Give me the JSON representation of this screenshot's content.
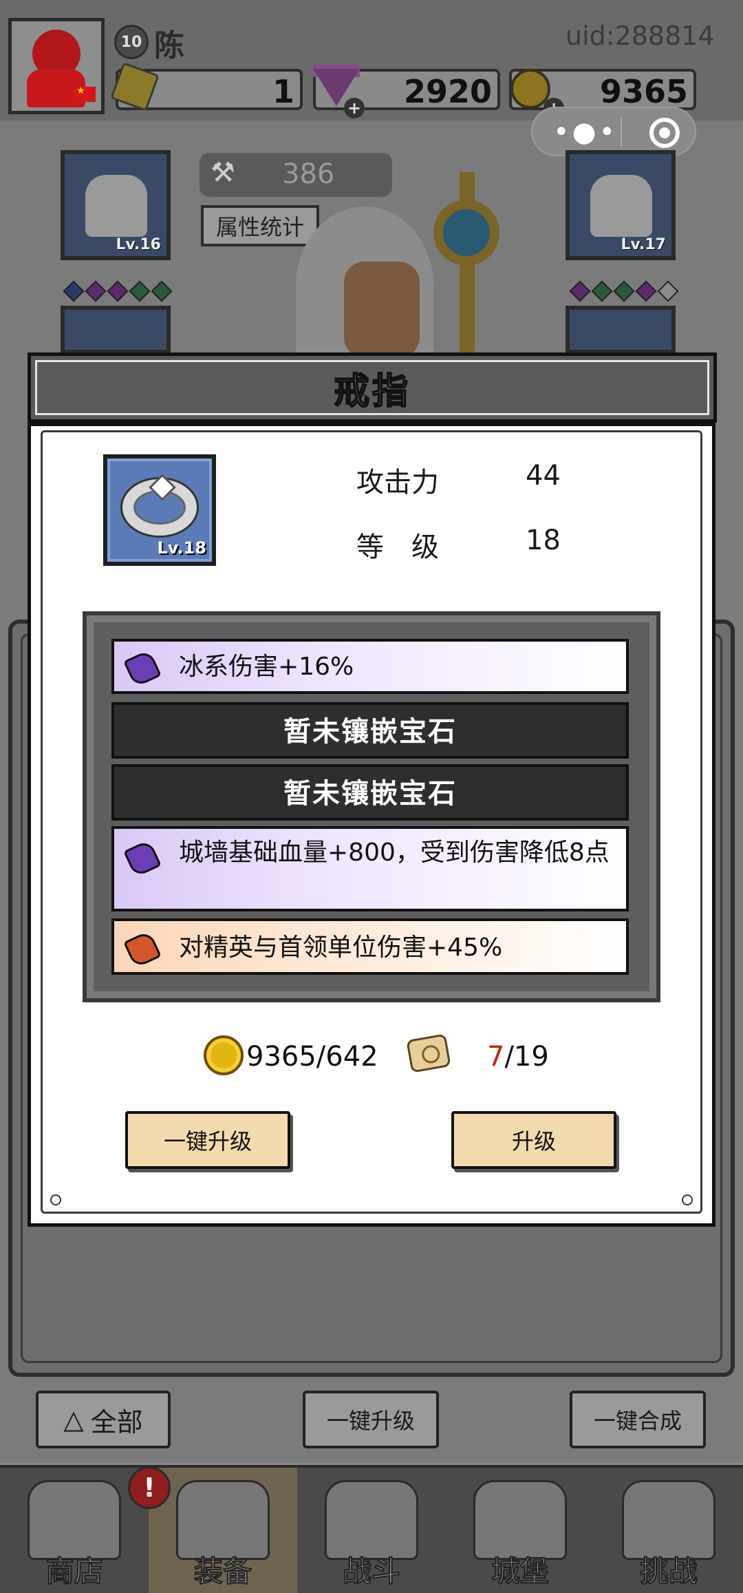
{
  "player": {
    "name": "陈",
    "level": "10",
    "uid": "uid:288814"
  },
  "resources": {
    "energy": "1",
    "diamonds": "2920",
    "gold": "9365"
  },
  "hero": {
    "power": "386",
    "stats_button": "属性统计",
    "left_slot_level": "Lv.16",
    "right_slot_level": "Lv.17"
  },
  "modal": {
    "title": "戒指",
    "item_level": "Lv.18",
    "attributes": [
      {
        "label": "攻击力",
        "value": "44"
      },
      {
        "label": "等　级",
        "value": "18"
      }
    ],
    "sockets": [
      {
        "type": "purple",
        "text": "冰系伤害+16%"
      },
      {
        "type": "empty",
        "text": "暂未镶嵌宝石"
      },
      {
        "type": "empty",
        "text": "暂未镶嵌宝石"
      },
      {
        "type": "purple",
        "text": "城墙基础血量+800，受到伤害降低8点"
      },
      {
        "type": "orange",
        "text": "对精英与首领单位伤害+45%"
      }
    ],
    "gold_cost": "9365/642",
    "scroll_have": "7",
    "scroll_need": "/19",
    "btn_one_key": "一键升级",
    "btn_upgrade": "升级"
  },
  "bottom": {
    "filter_all": "全部",
    "one_key_upgrade": "一键升级",
    "one_key_merge": "一键合成"
  },
  "tabs": [
    {
      "label": "商店"
    },
    {
      "label": "装备"
    },
    {
      "label": "战斗"
    },
    {
      "label": "城堡"
    },
    {
      "label": "挑战"
    }
  ],
  "badge": "!",
  "colors": {
    "socket_purple": "#6a3fb5",
    "socket_orange": "#d2572a",
    "scroll_have_red": "#d11a1a",
    "button_fill": "#f3d9ae"
  }
}
